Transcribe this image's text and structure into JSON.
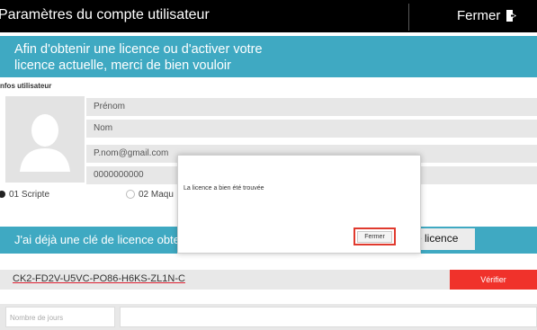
{
  "header": {
    "title": "Paramètres du compte utilisateur",
    "close_label": "Fermer",
    "close_icon": "exit-door-icon"
  },
  "banner": {
    "line1": "Afin d'obtenir une licence ou d'activer votre",
    "line2": "licence actuelle, merci de bien vouloir"
  },
  "user_info": {
    "section_label": "nfos utilisateur",
    "avatar_icon": "user-silhouette-icon",
    "first_name": "Prénom",
    "last_name": "Nom",
    "email": "P.nom@gmail.com",
    "phone": "0000000000"
  },
  "options": {
    "opt1_label": "01  Scripte",
    "opt1_selected": true,
    "opt2_label": "02  Maqu",
    "opt2_selected": false
  },
  "licence": {
    "have_key_text": "J'ai déjà une clé de licence obte",
    "button_label": "e licence",
    "key_value": "CK2-FD2V-U5VC-PO86-H6KS-ZL1N-C",
    "verify_label": "Vérifier",
    "days_placeholder": "Nombre de jours"
  },
  "dialog": {
    "message": "La licence a bien été trouvée",
    "button_label": "Fermer"
  },
  "colors": {
    "accent": "#3fa9c2",
    "danger": "#f0322b",
    "titlebar": "#000000"
  }
}
